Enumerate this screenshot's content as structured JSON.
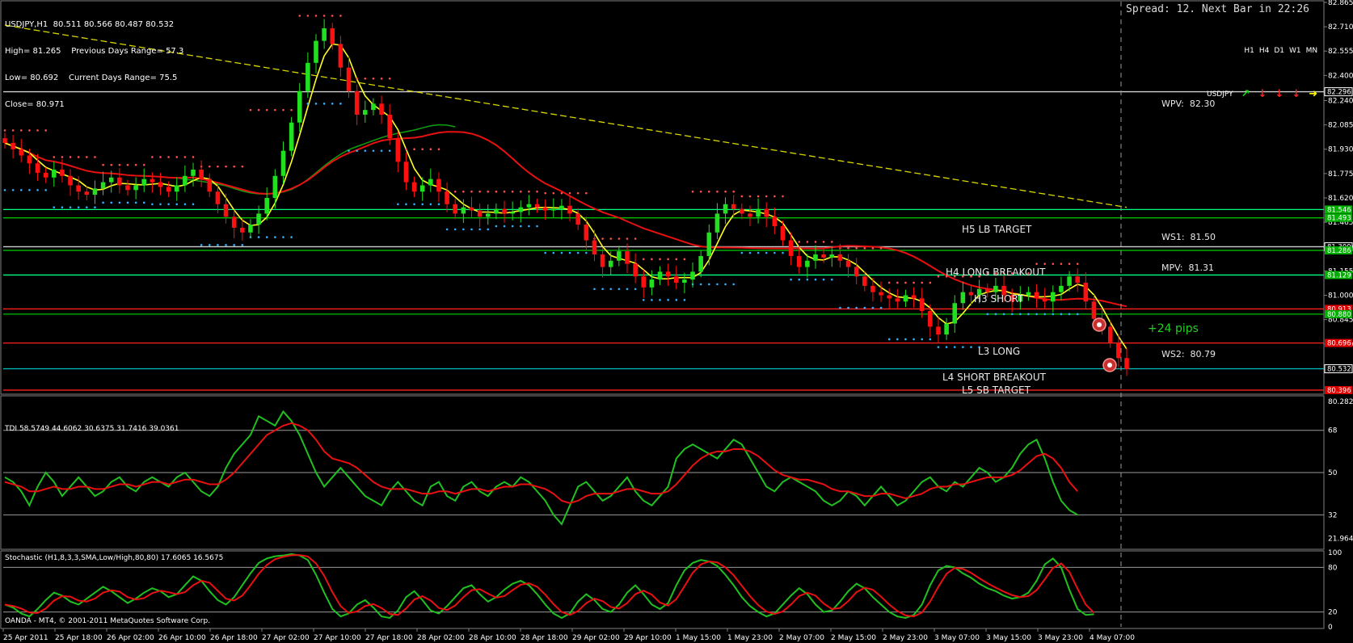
{
  "header": {
    "line1": "USDJPY,H1  80.511 80.566 80.487 80.532",
    "line2": "High= 81.265    Previous Days Range= 57.3",
    "line3": "Low= 80.692    Current Days Range= 75.5",
    "line4": "Close= 80.971"
  },
  "spread_text": "Spread: 12. Next Bar in 22:26",
  "timeframes": {
    "labels": [
      "H1",
      "H4",
      "D1",
      "W1",
      "MN"
    ],
    "symbol": "USDJPY",
    "arrows": [
      {
        "icon": "arrow-up-icon",
        "color": "#22cc22"
      },
      {
        "icon": "arrow-down-icon",
        "color": "#ff2020"
      },
      {
        "icon": "arrow-down-icon",
        "color": "#ff2020"
      },
      {
        "icon": "arrow-down-icon",
        "color": "#ff2020"
      },
      {
        "icon": "arrow-right-icon",
        "color": "#ffff00"
      }
    ]
  },
  "levels": {
    "h5": "H5 LB TARGET",
    "h4": "H4 LONG BREAKOUT",
    "h3": "H3 SHORT",
    "l3": "L3 LONG",
    "l4": "L4 SHORT BREAKOUT",
    "l5": "L5 SB TARGET"
  },
  "pivots": {
    "wpv": "WPV:  82.30",
    "ws1": "WS1:  81.50",
    "mpv": "MPV:  81.31",
    "ws2": "WS2:  80.79"
  },
  "pips_text": "+24 pips",
  "tdi_label": "TDI 58.5749 44.6062 30.6375 31.7416 39.0361",
  "stoch_label": "Stochastic (H1,8,3,3,SMA,Low/High,80,80) 17.6065 16.5675",
  "copyright": "OANDA - MT4, © 2001-2011 MetaQuotes Software Corp.",
  "chart_data": [
    {
      "type": "candlestick",
      "title": "USDJPY,H1",
      "y_axis_ticks": [
        "82.865",
        "82.710",
        "82.555",
        "82.400",
        "82.240",
        "82.085",
        "81.930",
        "81.775",
        "81.620",
        "81.465",
        "81.310",
        "81.155",
        "81.000",
        "80.845",
        "80.690"
      ],
      "ylim": [
        80.37,
        82.87
      ],
      "price_tags": [
        {
          "text": "82.296",
          "value": 82.296,
          "color": "#ffffff"
        },
        {
          "text": "81.546",
          "value": 81.546,
          "color": "#00b000"
        },
        {
          "text": "81.493",
          "value": 81.493,
          "color": "#00b000"
        },
        {
          "text": "81.309",
          "value": 81.309,
          "color": "#ffffff"
        },
        {
          "text": "81.286",
          "value": 81.286,
          "color": "#00b000"
        },
        {
          "text": "81.129",
          "value": 81.129,
          "color": "#00b000"
        },
        {
          "text": "80.913",
          "value": 80.913,
          "color": "#e00000"
        },
        {
          "text": "80.880",
          "value": 80.88,
          "color": "#00b000"
        },
        {
          "text": "80.696",
          "value": 80.696,
          "color": "#e00000"
        },
        {
          "text": "80.532",
          "value": 80.532,
          "color": "#ffffff"
        },
        {
          "text": "80.396",
          "value": 80.396,
          "color": "#e00000"
        }
      ],
      "x_labels": [
        "25 Apr 2011",
        "25 Apr 18:00",
        "26 Apr 02:00",
        "26 Apr 10:00",
        "26 Apr 18:00",
        "27 Apr 02:00",
        "27 Apr 10:00",
        "27 Apr 18:00",
        "28 Apr 02:00",
        "28 Apr 10:00",
        "28 Apr 18:00",
        "29 Apr 02:00",
        "29 Apr 10:00",
        "1 May 15:00",
        "1 May 23:00",
        "2 May 07:00",
        "2 May 15:00",
        "2 May 23:00",
        "3 May 07:00",
        "3 May 15:00",
        "3 May 23:00",
        "4 May 07:00"
      ],
      "horizontal_levels": [
        {
          "name": "WPV",
          "value": 82.296,
          "color": "#d0d0d0"
        },
        {
          "name": "H5",
          "value": 81.546,
          "color": "#00ff80"
        },
        {
          "name": "WS1",
          "value": 81.493,
          "color": "#00c000"
        },
        {
          "name": "MPV",
          "value": 81.309,
          "color": "#d0d0d0"
        },
        {
          "name": "H4",
          "value": 81.286,
          "color": "#00c000"
        },
        {
          "name": "H3",
          "value": 81.129,
          "color": "#00ff80"
        },
        {
          "name": "L3",
          "value": 80.913,
          "color": "#ff2020"
        },
        {
          "name": "WS2",
          "value": 80.88,
          "color": "#00c000"
        },
        {
          "name": "L4",
          "value": 80.696,
          "color": "#ff2020"
        },
        {
          "name": "Close",
          "value": 80.532,
          "color": "#00c0c0"
        },
        {
          "name": "L5",
          "value": 80.396,
          "color": "#ff2020"
        }
      ],
      "close": [
        81.97,
        81.93,
        81.89,
        81.84,
        81.78,
        81.75,
        81.8,
        81.76,
        81.7,
        81.66,
        81.64,
        81.68,
        81.72,
        81.75,
        81.7,
        81.67,
        81.7,
        81.74,
        81.72,
        81.69,
        81.66,
        81.7,
        81.76,
        81.8,
        81.74,
        81.66,
        81.58,
        81.5,
        81.43,
        81.4,
        81.45,
        81.52,
        81.62,
        81.76,
        81.92,
        82.1,
        82.3,
        82.48,
        82.62,
        82.7,
        82.6,
        82.45,
        82.3,
        82.15,
        82.18,
        82.22,
        82.15,
        82.0,
        81.85,
        81.72,
        81.66,
        81.7,
        81.74,
        81.66,
        81.58,
        81.52,
        81.56,
        81.54,
        81.5,
        81.52,
        81.55,
        81.52,
        81.53,
        81.56,
        81.58,
        81.56,
        81.54,
        81.55,
        81.57,
        81.52,
        81.45,
        81.35,
        81.26,
        81.18,
        81.22,
        81.28,
        81.2,
        81.12,
        81.05,
        81.1,
        81.15,
        81.12,
        81.08,
        81.1,
        81.15,
        81.25,
        81.4,
        81.52,
        81.58,
        81.55,
        81.52,
        81.5,
        81.55,
        81.5,
        81.44,
        81.35,
        81.25,
        81.18,
        81.22,
        81.26,
        81.24,
        81.26,
        81.22,
        81.18,
        81.12,
        81.06,
        81.02,
        81.0,
        80.98,
        80.96,
        81.0,
        80.98,
        80.9,
        80.8,
        80.75,
        80.82,
        80.95,
        81.02,
        81.0,
        81.04,
        81.02,
        81.06,
        81.0,
        80.96,
        81.0,
        81.02,
        80.98,
        80.96,
        81.02,
        81.06,
        81.12,
        81.08,
        80.96,
        80.85,
        80.8,
        80.7,
        80.6,
        80.53
      ]
    },
    {
      "type": "line",
      "title": "TDI",
      "y_axis_ticks": [
        "80.2828",
        "68",
        "50",
        "32",
        "21.964"
      ],
      "ylim": [
        18,
        82
      ],
      "series": [
        {
          "name": "TDI green",
          "color": "#20c020",
          "values": [
            48,
            46,
            42,
            36,
            44,
            50,
            46,
            40,
            44,
            48,
            44,
            40,
            42,
            46,
            48,
            44,
            42,
            46,
            48,
            46,
            44,
            48,
            50,
            46,
            42,
            40,
            44,
            52,
            58,
            62,
            66,
            74,
            72,
            70,
            76,
            72,
            66,
            58,
            50,
            44,
            48,
            52,
            48,
            44,
            40,
            38,
            36,
            42,
            46,
            42,
            38,
            36,
            44,
            46,
            40,
            38,
            44,
            46,
            42,
            40,
            44,
            46,
            44,
            48,
            46,
            42,
            38,
            32,
            28,
            36,
            44,
            46,
            42,
            38,
            40,
            44,
            48,
            42,
            38,
            36,
            40,
            44,
            56,
            60,
            62,
            60,
            58,
            56,
            60,
            64,
            62,
            56,
            50,
            44,
            42,
            46,
            48,
            46,
            44,
            42,
            38,
            36,
            38,
            42,
            40,
            36,
            40,
            44,
            40,
            36,
            38,
            42,
            46,
            48,
            44,
            42,
            46,
            44,
            48,
            52,
            50,
            46,
            48,
            52,
            58,
            62,
            64,
            56,
            46,
            38,
            34,
            32
          ]
        },
        {
          "name": "TDI red",
          "color": "#e81010",
          "values": [
            46,
            45,
            44,
            42,
            42,
            43,
            44,
            43,
            43,
            44,
            44,
            43,
            43,
            44,
            45,
            45,
            44,
            45,
            46,
            46,
            45,
            46,
            47,
            47,
            46,
            45,
            45,
            47,
            50,
            54,
            58,
            62,
            66,
            68,
            70,
            71,
            70,
            68,
            64,
            59,
            56,
            55,
            54,
            52,
            49,
            46,
            44,
            43,
            43,
            43,
            42,
            41,
            41,
            42,
            42,
            41,
            42,
            43,
            43,
            42,
            43,
            44,
            44,
            45,
            45,
            44,
            43,
            41,
            38,
            37,
            38,
            40,
            41,
            41,
            41,
            42,
            43,
            43,
            42,
            41,
            41,
            42,
            45,
            49,
            53,
            56,
            58,
            59,
            59,
            60,
            60,
            59,
            57,
            54,
            51,
            49,
            48,
            47,
            47,
            46,
            45,
            43,
            42,
            42,
            41,
            40,
            40,
            41,
            41,
            40,
            39,
            40,
            41,
            43,
            44,
            44,
            45,
            45,
            46,
            47,
            48,
            48,
            48,
            49,
            51,
            54,
            57,
            58,
            56,
            52,
            46,
            42
          ]
        }
      ],
      "levels": [
        68,
        50,
        32
      ]
    },
    {
      "type": "line",
      "title": "Stochastic (H1,8,3,3,SMA,Low/High,80,80)",
      "y_axis_ticks": [
        "100",
        "80",
        "20",
        "0"
      ],
      "ylim": [
        0,
        100
      ],
      "series": [
        {
          "name": "%K",
          "color": "#20c020"
        },
        {
          "name": "%D",
          "color": "#e81010"
        }
      ],
      "values": [
        30,
        26,
        18,
        14,
        24,
        36,
        46,
        42,
        34,
        30,
        38,
        46,
        54,
        48,
        40,
        32,
        38,
        46,
        52,
        48,
        40,
        44,
        56,
        68,
        62,
        48,
        36,
        30,
        40,
        56,
        72,
        86,
        92,
        95,
        96,
        98,
        96,
        90,
        70,
        46,
        24,
        14,
        18,
        30,
        36,
        26,
        14,
        12,
        22,
        40,
        48,
        36,
        22,
        18,
        28,
        40,
        52,
        56,
        44,
        34,
        40,
        50,
        58,
        62,
        56,
        44,
        30,
        18,
        12,
        18,
        34,
        44,
        36,
        24,
        20,
        30,
        46,
        56,
        44,
        30,
        24,
        32,
        56,
        76,
        86,
        90,
        88,
        82,
        70,
        56,
        40,
        28,
        20,
        14,
        18,
        30,
        42,
        52,
        44,
        30,
        20,
        22,
        34,
        48,
        58,
        52,
        40,
        30,
        20,
        14,
        12,
        16,
        30,
        56,
        76,
        82,
        80,
        72,
        66,
        58,
        52,
        48,
        42,
        38,
        40,
        46,
        62,
        84,
        92,
        80,
        50,
        24,
        16,
        17
      ]
    }
  ]
}
